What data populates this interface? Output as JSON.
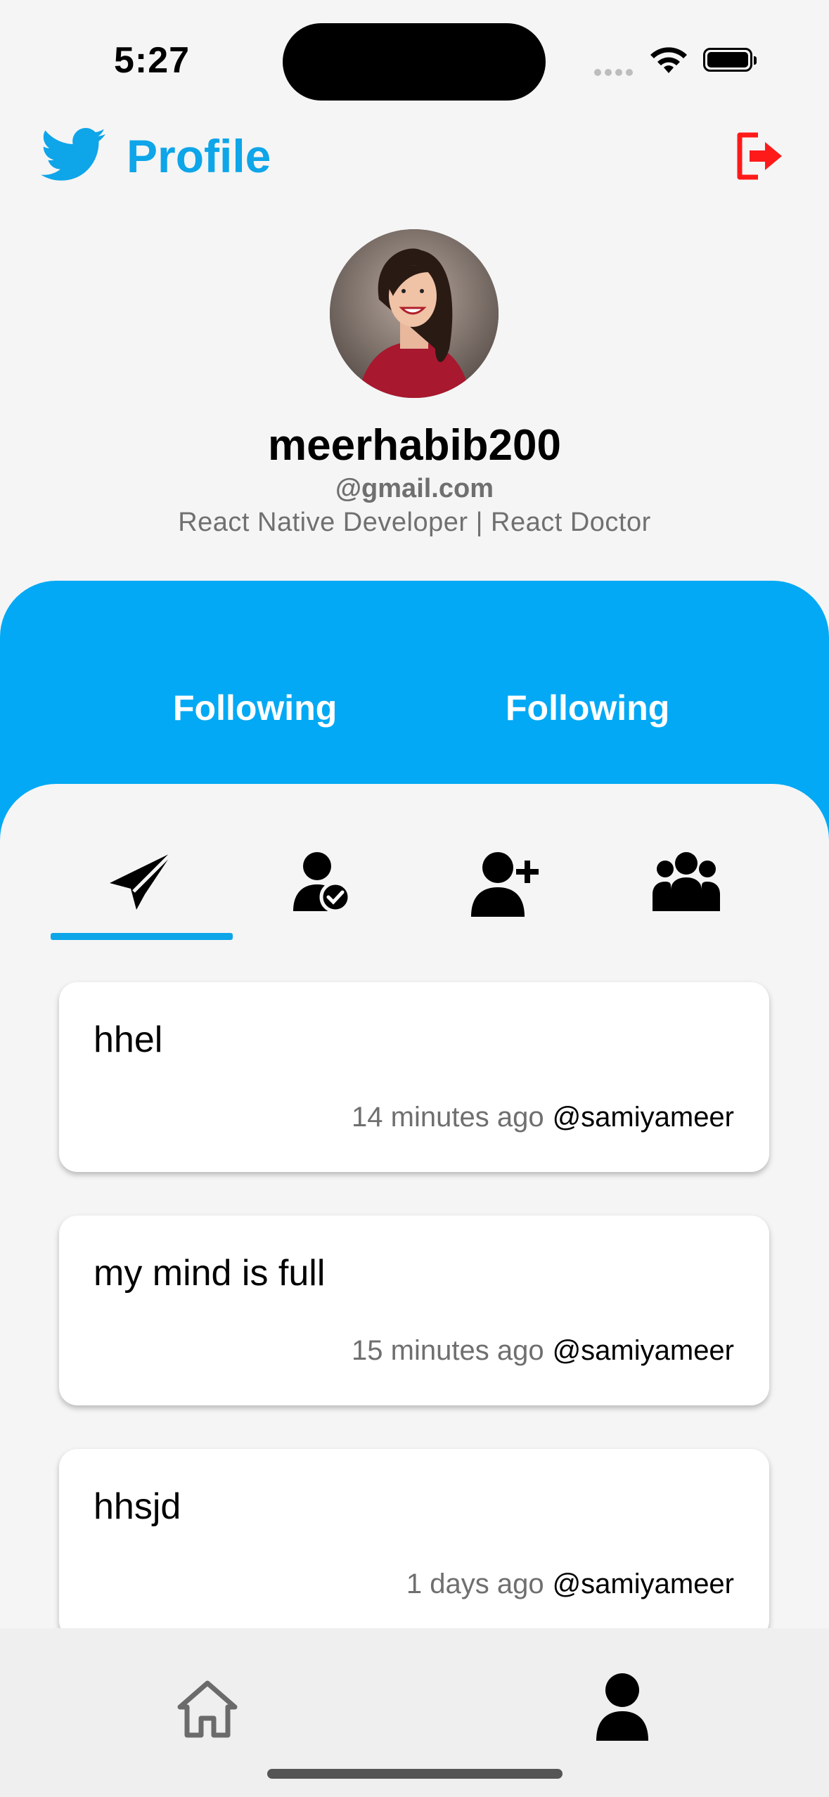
{
  "status_bar": {
    "time": "5:27"
  },
  "header": {
    "title": "Profile"
  },
  "profile": {
    "username": "meerhabib200",
    "email": "@gmail.com",
    "bio": "React Native Developer | React Doctor"
  },
  "stats": [
    {
      "label": "Following"
    },
    {
      "label": "Following"
    }
  ],
  "tabs": [
    {
      "icon": "paper-plane-icon",
      "active": true
    },
    {
      "icon": "user-check-icon",
      "active": false
    },
    {
      "icon": "user-plus-icon",
      "active": false
    },
    {
      "icon": "users-icon",
      "active": false
    }
  ],
  "posts": [
    {
      "text": "hhel",
      "time": "14 minutes ago",
      "handle": "@samiyameer"
    },
    {
      "text": "my mind is full",
      "time": "15 minutes ago",
      "handle": "@samiyameer"
    },
    {
      "text": "hhsjd",
      "time": "1 days ago",
      "handle": "@samiyameer"
    }
  ],
  "bottom_nav": [
    {
      "icon": "home-icon",
      "active": false
    },
    {
      "icon": "profile-icon",
      "active": true
    }
  ],
  "colors": {
    "accent": "#0ea5e9",
    "panel": "#03a9f4",
    "logout": "#ff1a1a"
  }
}
